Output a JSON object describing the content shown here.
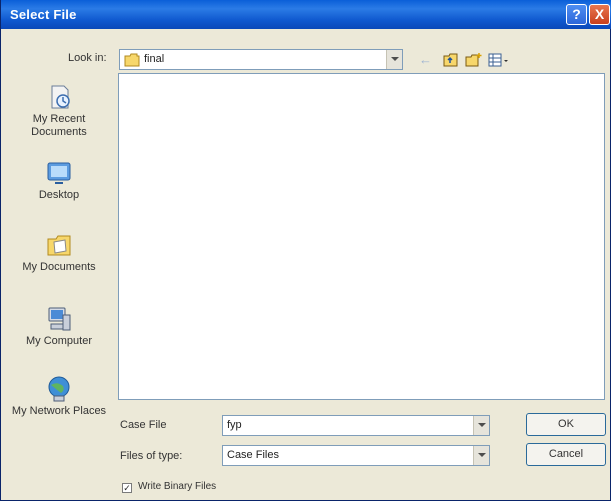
{
  "title": "Select File",
  "title_buttons": {
    "help": "?",
    "close": "X"
  },
  "look_in": {
    "label": "Look in:",
    "value": "final"
  },
  "places": [
    {
      "label": "My Recent Documents",
      "icon": "recent-documents-icon"
    },
    {
      "label": "Desktop",
      "icon": "desktop-icon"
    },
    {
      "label": "My Documents",
      "icon": "my-documents-icon"
    },
    {
      "label": "My Computer",
      "icon": "my-computer-icon"
    },
    {
      "label": "My Network Places",
      "icon": "network-places-icon"
    }
  ],
  "case_file": {
    "label": "Case File",
    "value": "fyp"
  },
  "files_of_type": {
    "label": "Files of type:",
    "value": "Case Files"
  },
  "buttons": {
    "ok": "OK",
    "cancel": "Cancel"
  },
  "write_binary": {
    "label": "Write Binary Files",
    "checked": true
  }
}
